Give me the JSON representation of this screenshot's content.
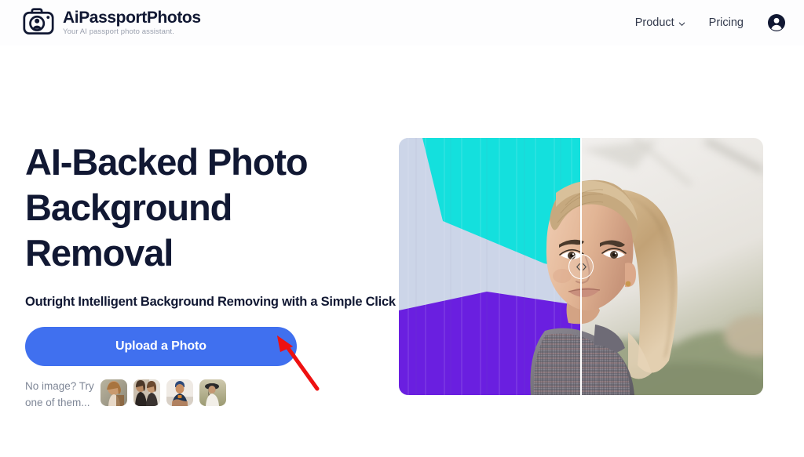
{
  "header": {
    "brand": {
      "logo_icon": "camera-portrait-icon",
      "name": "AiPassportPhotos",
      "tagline": "Your AI passport photo assistant."
    },
    "nav": {
      "product_label": "Product",
      "product_chevron_icon": "chevron-down-icon",
      "pricing_label": "Pricing",
      "account_icon": "account-avatar-icon"
    }
  },
  "hero": {
    "headline": "AI-Backed Photo Background Removal",
    "subheadline": "Outright Intelligent Background Removing with a Simple Click",
    "upload_button_label": "Upload a Photo",
    "samples": {
      "label": "No image? Try one of them...",
      "thumbnails": [
        {
          "name": "sample-thumb-1",
          "alt": "woman with curly hair outdoors"
        },
        {
          "name": "sample-thumb-2",
          "alt": "two women standing together"
        },
        {
          "name": "sample-thumb-3",
          "alt": "man in blue tank top with cap"
        },
        {
          "name": "sample-thumb-4",
          "alt": "woman in white dress with hat"
        }
      ]
    },
    "comparison": {
      "before_alt": "woman in front of painted cyan white and purple wall",
      "after_alt": "woman with blonde ponytail on blurred outdoor background",
      "slider_position_percent": 50,
      "handle_left_icon": "chevron-left-icon",
      "handle_right_icon": "chevron-right-icon"
    }
  },
  "annotation": {
    "arrow_icon": "red-pointer-arrow",
    "color": "#ee1111"
  },
  "colors": {
    "accent_blue": "#4070ef",
    "text_dark": "#111833",
    "text_muted": "#7f8797",
    "page_background": "#ffffff",
    "wall_cyan": "#14e0dd",
    "wall_lavender": "#ccd5e8",
    "wall_purple": "#6a1fe0"
  }
}
